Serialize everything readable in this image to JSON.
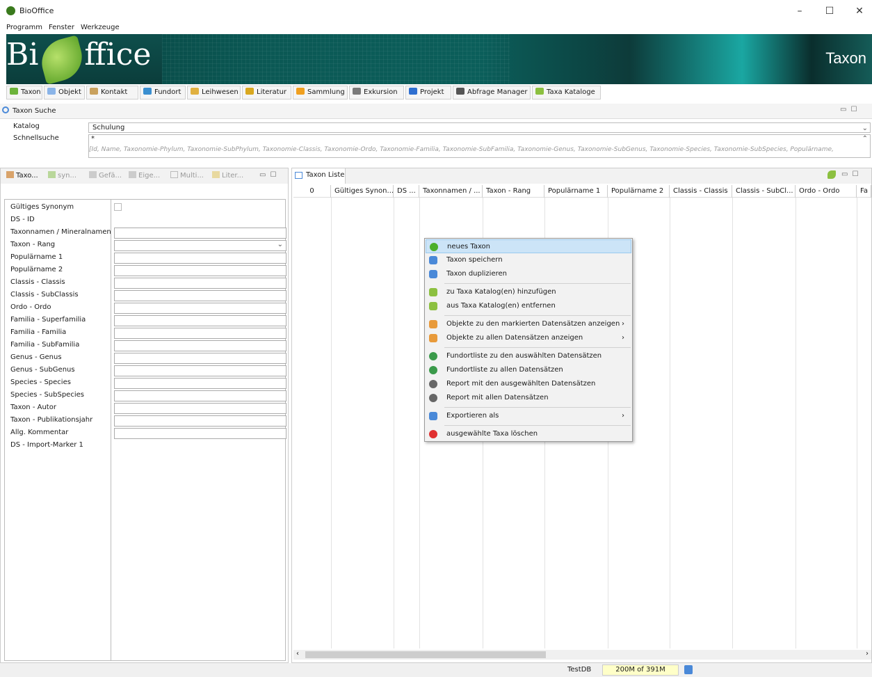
{
  "window": {
    "title": "BioOffice",
    "controls": [
      "–",
      "☐",
      "✕"
    ]
  },
  "menu": [
    "Programm",
    "Fenster",
    "Werkzeuge"
  ],
  "banner": {
    "logo_left": "Bi",
    "logo_right": "ffice",
    "module": "Taxon"
  },
  "toolbar": [
    {
      "label": "Taxon",
      "color": "#6cb33a"
    },
    {
      "label": "Objekt",
      "color": "#8ab4e8"
    },
    {
      "label": "Kontakt",
      "color": "#c9a15d"
    },
    {
      "label": "Fundort",
      "color": "#3a8fd0"
    },
    {
      "label": "Leihwesen",
      "color": "#e0b040"
    },
    {
      "label": "Literatur",
      "color": "#d9a820"
    },
    {
      "label": "Sammlung",
      "color": "#f0a020"
    },
    {
      "label": "Exkursion",
      "color": "#7a7a7a"
    },
    {
      "label": "Projekt",
      "color": "#2f6fd0"
    },
    {
      "label": "Abfrage Manager",
      "color": "#555555"
    },
    {
      "label": "Taxa Kataloge",
      "color": "#8cc040"
    }
  ],
  "search": {
    "title": "Taxon Suche",
    "katalog_label": "Katalog",
    "katalog_value": "Schulung",
    "schnell_label": "Schnellsuche",
    "schnell_value": "*",
    "hint": "[Id, Name, Taxonomie-Phylum, Taxonomie-SubPhylum, Taxonomie-Classis, Taxonomie-Ordo, Taxonomie-Familia, Taxonomie-SubFamilia, Taxonomie-Genus, Taxonomie-SubGenus, Taxonomie-Species, Taxonomie-SubSpecies, Populärname,"
  },
  "left_tabs": [
    "Taxo...",
    "syn...",
    "Gefä...",
    "Eige...",
    "Multi...",
    "Liter..."
  ],
  "form_fields": [
    {
      "label": "Gültiges Synonym",
      "type": "check"
    },
    {
      "label": "DS - ID",
      "type": "none"
    },
    {
      "label": "Taxonnamen / Mineralnamen",
      "type": "text"
    },
    {
      "label": "Taxon - Rang",
      "type": "select"
    },
    {
      "label": "Populärname 1",
      "type": "text"
    },
    {
      "label": "Populärname 2",
      "type": "text"
    },
    {
      "label": "Classis - Classis",
      "type": "text"
    },
    {
      "label": "Classis - SubClassis",
      "type": "text"
    },
    {
      "label": "Ordo - Ordo",
      "type": "text"
    },
    {
      "label": "Familia - Superfamilia",
      "type": "text"
    },
    {
      "label": "Familia - Familia",
      "type": "text"
    },
    {
      "label": "Familia - SubFamilia",
      "type": "text"
    },
    {
      "label": "Genus - Genus",
      "type": "text"
    },
    {
      "label": "Genus - SubGenus",
      "type": "text"
    },
    {
      "label": "Species - Species",
      "type": "text"
    },
    {
      "label": "Species - SubSpecies",
      "type": "text"
    },
    {
      "label": "Taxon - Autor",
      "type": "text"
    },
    {
      "label": "Taxon  - Publikationsjahr",
      "type": "text"
    },
    {
      "label": "Allg. Kommentar",
      "type": "text"
    },
    {
      "label": "DS - Import-Marker 1",
      "type": "none"
    }
  ],
  "list": {
    "tab": "Taxon Liste",
    "columns": [
      "0",
      "Gültiges Synon...",
      "DS ...",
      "Taxonnamen / ...",
      "Taxon - Rang",
      "Populärname 1",
      "Populärname 2",
      "Classis - Classis",
      "Classis - SubCl...",
      "Ordo - Ordo",
      "Fa"
    ]
  },
  "context_menu": [
    {
      "label": "neues Taxon",
      "icon": "plus-icon",
      "color": "#4caf2a",
      "highlight": true
    },
    {
      "label": "Taxon speichern",
      "icon": "save-icon",
      "color": "#4a89d8"
    },
    {
      "label": "Taxon duplizieren",
      "icon": "duplicate-icon",
      "color": "#4a89d8"
    },
    {
      "sep": true
    },
    {
      "label": "zu Taxa Katalog(en) hinzufügen",
      "icon": "catalog-add-icon",
      "color": "#8cc040"
    },
    {
      "label": "aus Taxa Katalog(en) entfernen",
      "icon": "catalog-remove-icon",
      "color": "#8cc040"
    },
    {
      "sep": true
    },
    {
      "label": "Objekte zu den markierten Datensätzen anzeigen",
      "icon": "objects-icon",
      "color": "#e89a3a",
      "submenu": true
    },
    {
      "label": "Objekte zu allen Datensätzen anzeigen",
      "icon": "objects-icon",
      "color": "#e89a3a",
      "submenu": true
    },
    {
      "sep": true
    },
    {
      "label": "Fundortliste zu den auswählten Datensätzen",
      "icon": "globe-icon",
      "color": "#3a9a4a"
    },
    {
      "label": "Fundortliste zu allen Datensätzen",
      "icon": "globe-icon",
      "color": "#3a9a4a"
    },
    {
      "label": "Report mit den ausgewählten Datensätzen",
      "icon": "report-icon",
      "color": "#666666"
    },
    {
      "label": "Report mit allen Datensätzen",
      "icon": "report-icon",
      "color": "#666666"
    },
    {
      "sep": true
    },
    {
      "label": "Exportieren als",
      "icon": "export-icon",
      "color": "#4a89d8",
      "submenu": true
    },
    {
      "sep": true
    },
    {
      "label": "ausgewählte Taxa löschen",
      "icon": "delete-icon",
      "color": "#e03030"
    }
  ],
  "status": {
    "db": "TestDB",
    "memory": "200M of 391M"
  }
}
